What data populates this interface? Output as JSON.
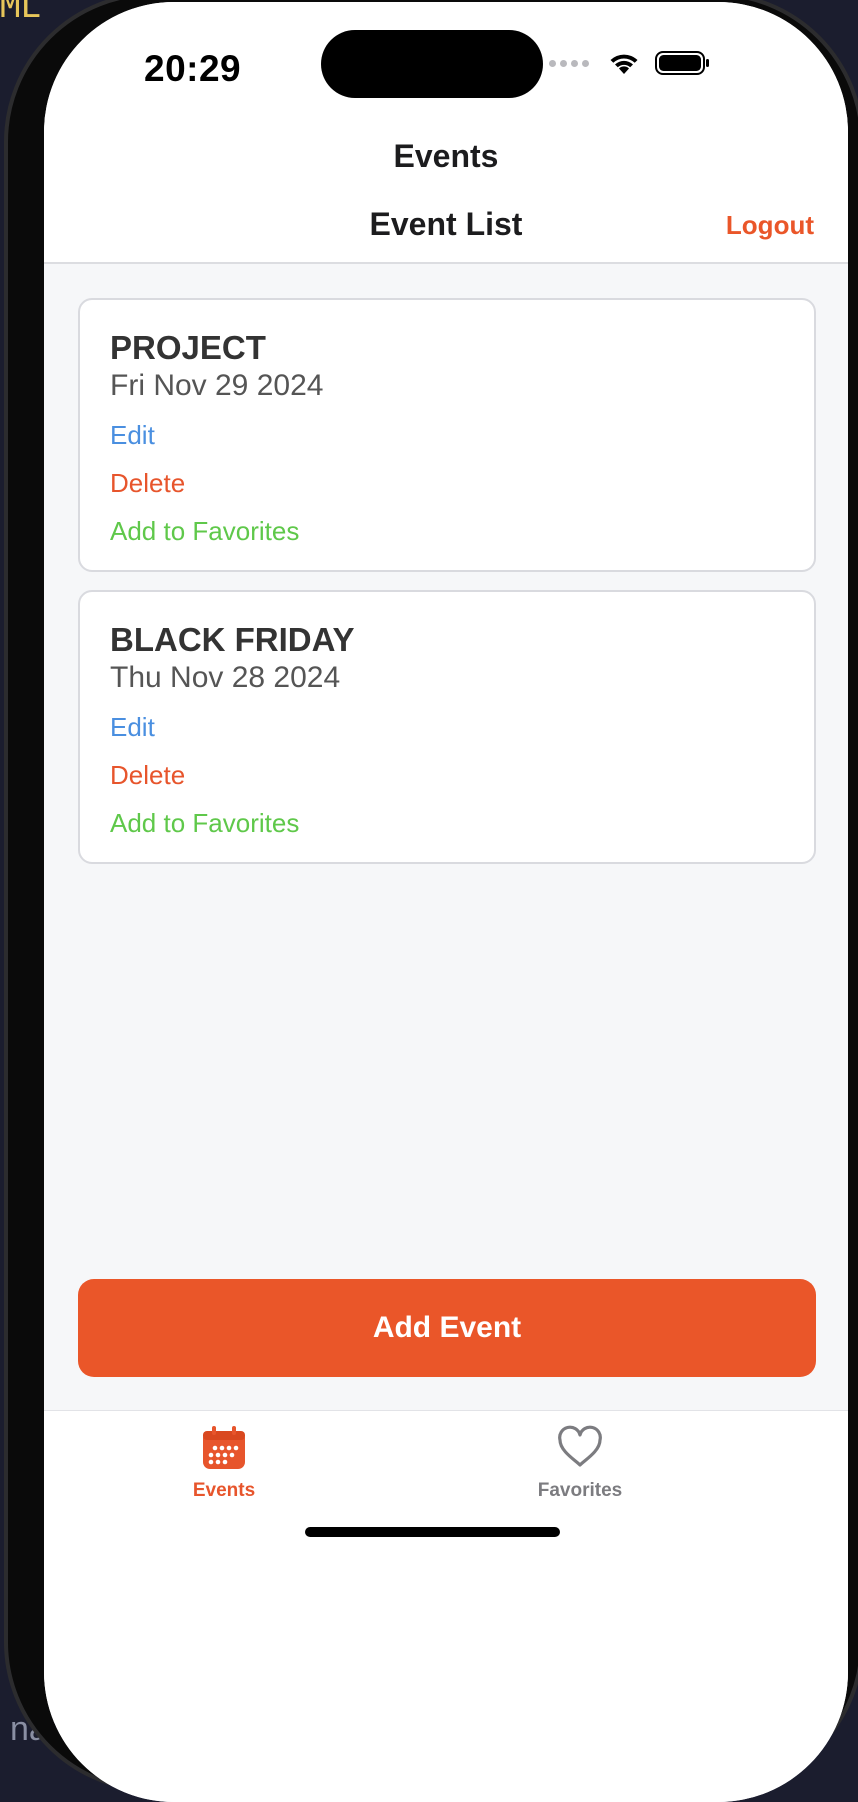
{
  "background": {
    "top_text": "ML",
    "bottom_text": "na"
  },
  "status_bar": {
    "time": "20:29"
  },
  "nav": {
    "title": "Events"
  },
  "header": {
    "title": "Event List",
    "logout_label": "Logout"
  },
  "events": [
    {
      "title": "PROJECT",
      "date": "Fri Nov 29 2024",
      "edit_label": "Edit",
      "delete_label": "Delete",
      "favorite_label": "Add to Favorites"
    },
    {
      "title": "BLACK FRIDAY",
      "date": "Thu Nov 28 2024",
      "edit_label": "Edit",
      "delete_label": "Delete",
      "favorite_label": "Add to Favorites"
    }
  ],
  "add_event_label": "Add Event",
  "tabs": [
    {
      "label": "Events",
      "icon": "calendar-icon",
      "active": true
    },
    {
      "label": "Favorites",
      "icon": "heart-icon",
      "active": false
    }
  ],
  "colors": {
    "accent": "#ea5629",
    "edit": "#4a8fe0",
    "delete": "#e7552c",
    "favorite": "#5fc84a",
    "inactive_tab": "#7c7c80"
  }
}
